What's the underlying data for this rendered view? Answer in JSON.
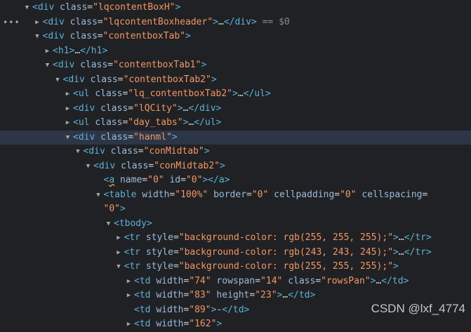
{
  "rows": [
    {
      "indent": 2,
      "twisty": "expanded",
      "tag": "div",
      "attrs": [
        {
          "name": "class",
          "value": "lqcontentBoxH"
        }
      ],
      "open_only": true
    },
    {
      "indent": 3,
      "twisty": "collapsed",
      "dots": true,
      "tag": "div",
      "attrs": [
        {
          "name": "class",
          "value": "lqcontentBoxheader"
        }
      ],
      "collapsed_close": true,
      "ref": "== $0"
    },
    {
      "indent": 3,
      "twisty": "expanded",
      "tag": "div",
      "attrs": [
        {
          "name": "class",
          "value": "contentboxTab"
        }
      ],
      "open_only": true
    },
    {
      "indent": 4,
      "twisty": "collapsed",
      "tag": "h1",
      "attrs": [],
      "collapsed_close": true
    },
    {
      "indent": 4,
      "twisty": "expanded",
      "tag": "div",
      "attrs": [
        {
          "name": "class",
          "value": "contentboxTab1"
        }
      ],
      "open_only": true
    },
    {
      "indent": 5,
      "twisty": "expanded",
      "tag": "div",
      "attrs": [
        {
          "name": "class",
          "value": "contentboxTab2"
        }
      ],
      "open_only": true
    },
    {
      "indent": 6,
      "twisty": "collapsed",
      "tag": "ul",
      "attrs": [
        {
          "name": "class",
          "value": "lq_contentboxTab2"
        }
      ],
      "collapsed_close": true
    },
    {
      "indent": 6,
      "twisty": "collapsed",
      "tag": "div",
      "attrs": [
        {
          "name": "class",
          "value": "lQCity"
        }
      ],
      "collapsed_close": true
    },
    {
      "indent": 6,
      "twisty": "collapsed",
      "tag": "ul",
      "attrs": [
        {
          "name": "class",
          "value": "day_tabs"
        }
      ],
      "collapsed_close": true
    },
    {
      "indent": 6,
      "twisty": "expanded",
      "tag": "div",
      "attrs": [
        {
          "name": "class",
          "value": "hanml"
        }
      ],
      "open_only": true,
      "selected": true
    },
    {
      "indent": 7,
      "twisty": "expanded",
      "tag": "div",
      "attrs": [
        {
          "name": "class",
          "value": "conMidtab"
        }
      ],
      "open_only": true
    },
    {
      "indent": 8,
      "twisty": "expanded",
      "tag": "div",
      "attrs": [
        {
          "name": "class",
          "value": "conMidtab2"
        }
      ],
      "open_only": true
    },
    {
      "indent": 9,
      "twisty": "none",
      "tag": "a",
      "attrs": [
        {
          "name": "name",
          "value": "0"
        },
        {
          "name": "id",
          "value": "0"
        }
      ],
      "empty_close": true,
      "wavy": true
    },
    {
      "indent": 9,
      "twisty": "expanded",
      "tag": "table",
      "attrs": [
        {
          "name": "width",
          "value": "100%"
        },
        {
          "name": "border",
          "value": "0"
        },
        {
          "name": "cellpadding",
          "value": "0"
        },
        {
          "name": "cellspacing",
          "value": null
        }
      ],
      "open_only": false,
      "wrap_start": true
    },
    {
      "indent": 9,
      "continuation": true,
      "cont_value": "0",
      "cont_suffix": ">"
    },
    {
      "indent": 10,
      "twisty": "expanded",
      "tag": "tbody",
      "attrs": [],
      "open_only": true
    },
    {
      "indent": 11,
      "twisty": "collapsed",
      "tag": "tr",
      "attrs": [
        {
          "name": "style",
          "value": "background-color: rgb(255, 255, 255);"
        }
      ],
      "collapsed_close": true
    },
    {
      "indent": 11,
      "twisty": "collapsed",
      "tag": "tr",
      "attrs": [
        {
          "name": "style",
          "value": "background-color: rgb(243, 243, 245);"
        }
      ],
      "collapsed_close": true
    },
    {
      "indent": 11,
      "twisty": "expanded",
      "tag": "tr",
      "attrs": [
        {
          "name": "style",
          "value": "background-color: rgb(255, 255, 255);"
        }
      ],
      "open_only": true
    },
    {
      "indent": 12,
      "twisty": "collapsed",
      "tag": "td",
      "attrs": [
        {
          "name": "width",
          "value": "74"
        },
        {
          "name": "rowspan",
          "value": "14"
        },
        {
          "name": "class",
          "value": "rowsPan"
        }
      ],
      "collapsed_close": true
    },
    {
      "indent": 12,
      "twisty": "collapsed",
      "tag": "td",
      "attrs": [
        {
          "name": "width",
          "value": "83"
        },
        {
          "name": "height",
          "value": "23"
        }
      ],
      "collapsed_close": true
    },
    {
      "indent": 12,
      "twisty": "none",
      "tag": "td",
      "attrs": [
        {
          "name": "width",
          "value": "89"
        }
      ],
      "inline_text": "-",
      "text_close": true
    },
    {
      "indent": 12,
      "twisty": "collapsed",
      "tag": "td",
      "attrs": [
        {
          "name": "width",
          "value": "162"
        }
      ],
      "partial": true
    }
  ],
  "labels": {
    "ellipsis": "…",
    "dots": "•••"
  },
  "watermark": "CSDN @lxf_4774",
  "colors": {
    "background": "#202124",
    "selected_row": "#2c3647",
    "tag": "#5db0d7",
    "attr_name": "#9bbbdc",
    "attr_value": "#f29766"
  },
  "icons": {
    "expanded": "triangle-down-icon",
    "collapsed": "triangle-right-icon"
  }
}
